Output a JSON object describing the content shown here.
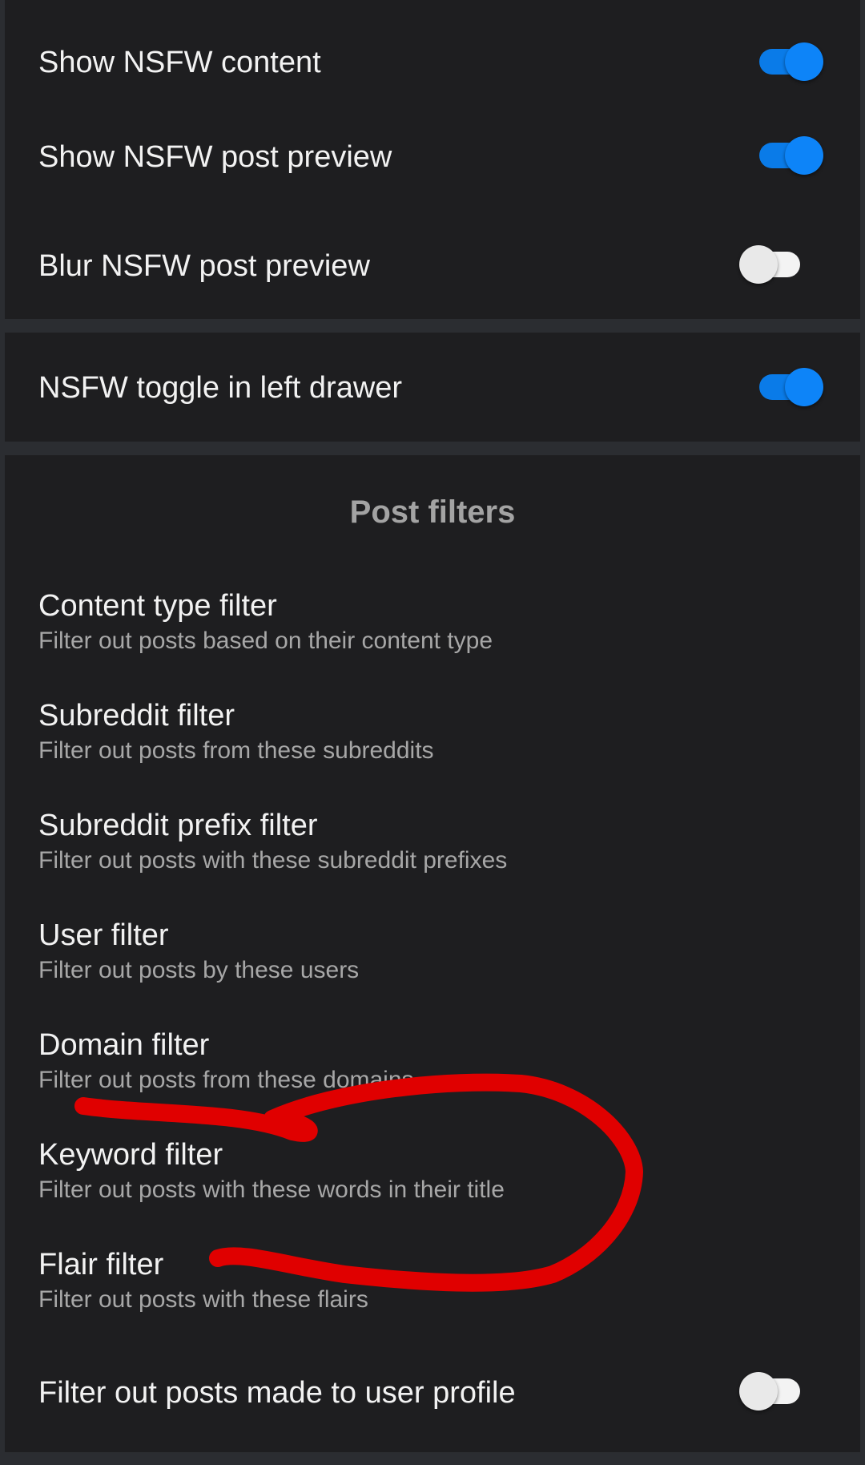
{
  "card1": {
    "rows": [
      {
        "label": "Show NSFW content",
        "toggle_on": true
      },
      {
        "label": "Show NSFW post preview",
        "toggle_on": true
      },
      {
        "label": "Blur NSFW post preview",
        "toggle_on": false
      }
    ]
  },
  "card2": {
    "rows": [
      {
        "label": "NSFW toggle in left drawer",
        "toggle_on": true
      }
    ]
  },
  "post_filters": {
    "heading": "Post filters",
    "items": [
      {
        "title": "Content type filter",
        "description": "Filter out posts based on their content type"
      },
      {
        "title": "Subreddit filter",
        "description": "Filter out posts from these subreddits"
      },
      {
        "title": "Subreddit prefix filter",
        "description": "Filter out posts with these subreddit prefixes"
      },
      {
        "title": "User filter",
        "description": "Filter out posts by these users"
      },
      {
        "title": "Domain filter",
        "description": "Filter out posts from these domains"
      },
      {
        "title": "Keyword filter",
        "description": "Filter out posts with these words in their title"
      },
      {
        "title": "Flair filter",
        "description": "Filter out posts with these flairs"
      }
    ],
    "user_profile_row": {
      "label": "Filter out posts made to user profile",
      "toggle_on": false
    }
  },
  "colors": {
    "toggle_on": "#0a7be8",
    "annotation_stroke": "#e00000",
    "card_background": "#1e1e20"
  }
}
